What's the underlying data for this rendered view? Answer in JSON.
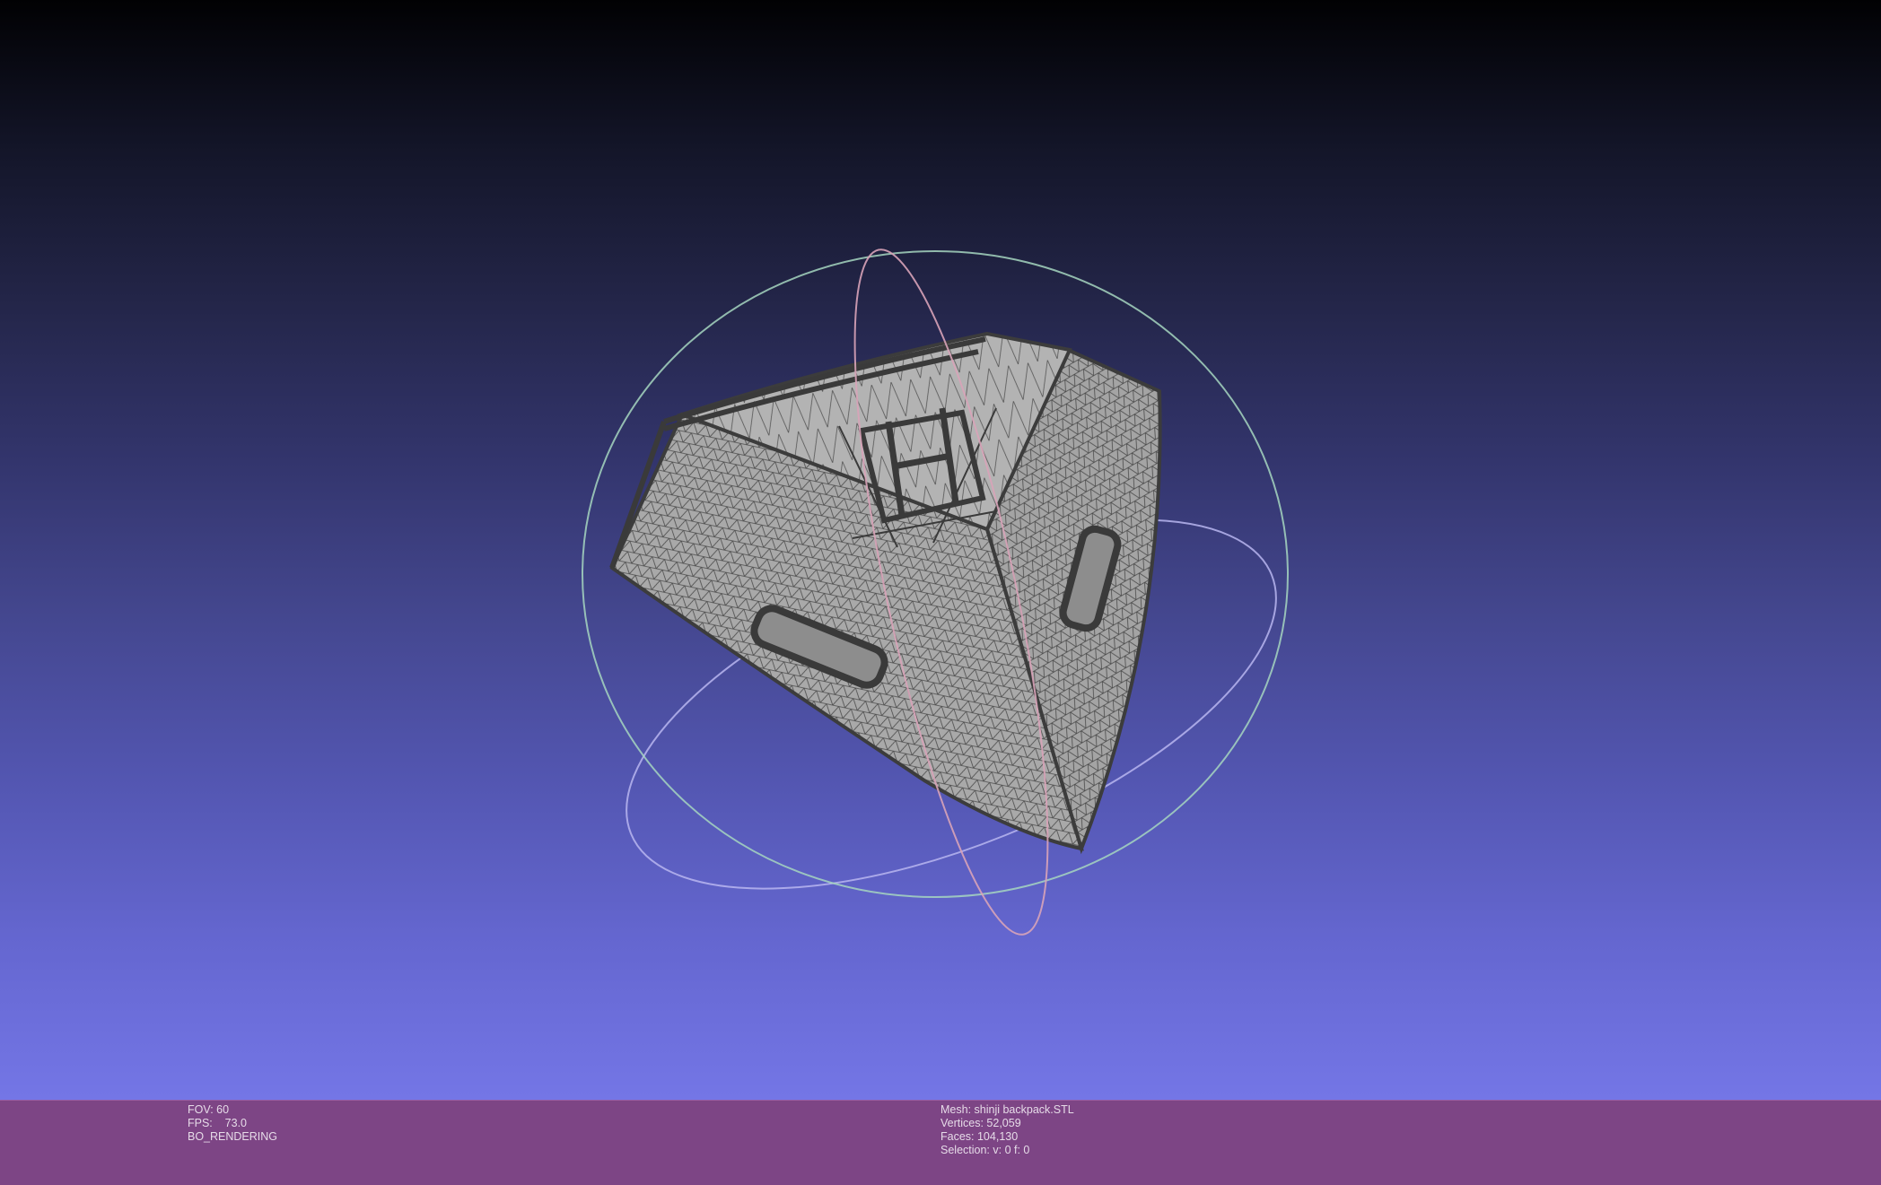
{
  "viewport": {
    "background_top": "#010103",
    "background_bottom": "#7476e6",
    "mesh_fill": "#a9a9a9",
    "wire_color": "#3c3c3c",
    "trackball_colors": {
      "horizontal": "#b9b6f0",
      "vertical": "#d8a3b8",
      "tilted": "#a6d6c0"
    }
  },
  "info_bar": {
    "background": "#7d4585",
    "left": {
      "fov": "FOV: 60",
      "fps": "FPS:    73.0",
      "mode": "BO_RENDERING"
    },
    "right": {
      "mesh": "Mesh: shinji backpack.STL",
      "vertices": "Vertices: 52,059",
      "faces": "Faces: 104,130",
      "selection": "Selection: v: 0 f: 0"
    }
  }
}
